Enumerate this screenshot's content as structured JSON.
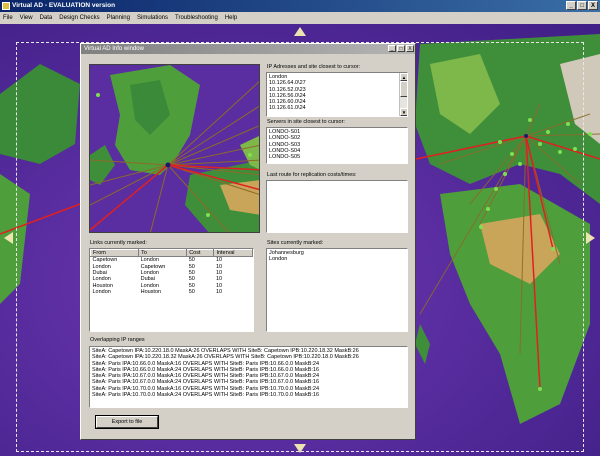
{
  "app": {
    "title": "Virtual AD - EVALUATION version",
    "window_buttons": [
      "_",
      "□",
      "X"
    ]
  },
  "menu": [
    "File",
    "View",
    "Data",
    "Design Checks",
    "Planning",
    "Simulations",
    "Troubleshooting",
    "Help"
  ],
  "info_window": {
    "title": "Virtual AD Info window",
    "buttons": [
      "_",
      "□",
      "X"
    ],
    "ip_label": "IP Adresses and site closest to cursor:",
    "ip_list": [
      "London",
      "10.126.64.0\\27",
      "10.126.52.0\\23",
      "10.126.56.0\\24",
      "10.126.60.0\\24",
      "10.126.61.0\\24"
    ],
    "servers_label": "Servers in site closest to cursor:",
    "servers": [
      "LONDO-S01",
      "LONDO-S02",
      "LONDO-S03",
      "LONDO-S04",
      "LONDO-S05"
    ],
    "route_label": "Last route for replication costs/times:",
    "links_label": "Links currently marked:",
    "links_headers": [
      "From",
      "To",
      "Cost",
      "Interval"
    ],
    "links_rows": [
      [
        "Capetown",
        "London",
        "50",
        "10"
      ],
      [
        "London",
        "Capetown",
        "50",
        "10"
      ],
      [
        "Dubai",
        "London",
        "50",
        "10"
      ],
      [
        "London",
        "Dubai",
        "50",
        "10"
      ],
      [
        "Houston",
        "London",
        "50",
        "10"
      ],
      [
        "London",
        "Houston",
        "50",
        "10"
      ]
    ],
    "sites_label": "Sites currently marked:",
    "sites": [
      "Johannesburg",
      "London"
    ],
    "overlap_label": "Overlapping IP ranges",
    "overlaps": [
      "SiteA: Capetown IPA:10.220.18.0 MaskA:26 OVERLAPS WITH SiteB: Capetown IPB:10.220.18.32 MaskB:26",
      "SiteA: Capetown IPA:10.220.18.32 MaskA:26 OVERLAPS WITH SiteB: Capetown IPB:10.220.18.0 MaskB:26",
      "SiteA: Paris IPA:10.66.0.0 MaskA:16 OVERLAPS WITH SiteB: Paris IPB:10.66.0.0 MaskB:24",
      "SiteA: Paris IPA:10.66.0.0 MaskA:24 OVERLAPS WITH SiteB: Paris IPB:10.66.0.0 MaskB:16",
      "SiteA: Paris IPA:10.67.0.0 MaskA:16 OVERLAPS WITH SiteB: Paris IPB:10.67.0.0 MaskB:24",
      "SiteA: Paris IPA:10.67.0.0 MaskA:24 OVERLAPS WITH SiteB: Paris IPB:10.67.0.0 MaskB:16",
      "SiteA: Paris IPA:10.70.0.0 MaskA:16 OVERLAPS WITH SiteB: Paris IPB:10.70.0.0 MaskB:24",
      "SiteA: Paris IPA:10.70.0.0 MaskA:24 OVERLAPS WITH SiteB: Paris IPB:10.70.0.0 MaskB:16"
    ],
    "export_label": "Export to file"
  },
  "colors": {
    "ocean": "#5a2da0",
    "land": "#3f8f3a",
    "link_red": "#e02020",
    "link_brown": "#8c6a2a",
    "site": "#7ee050"
  }
}
